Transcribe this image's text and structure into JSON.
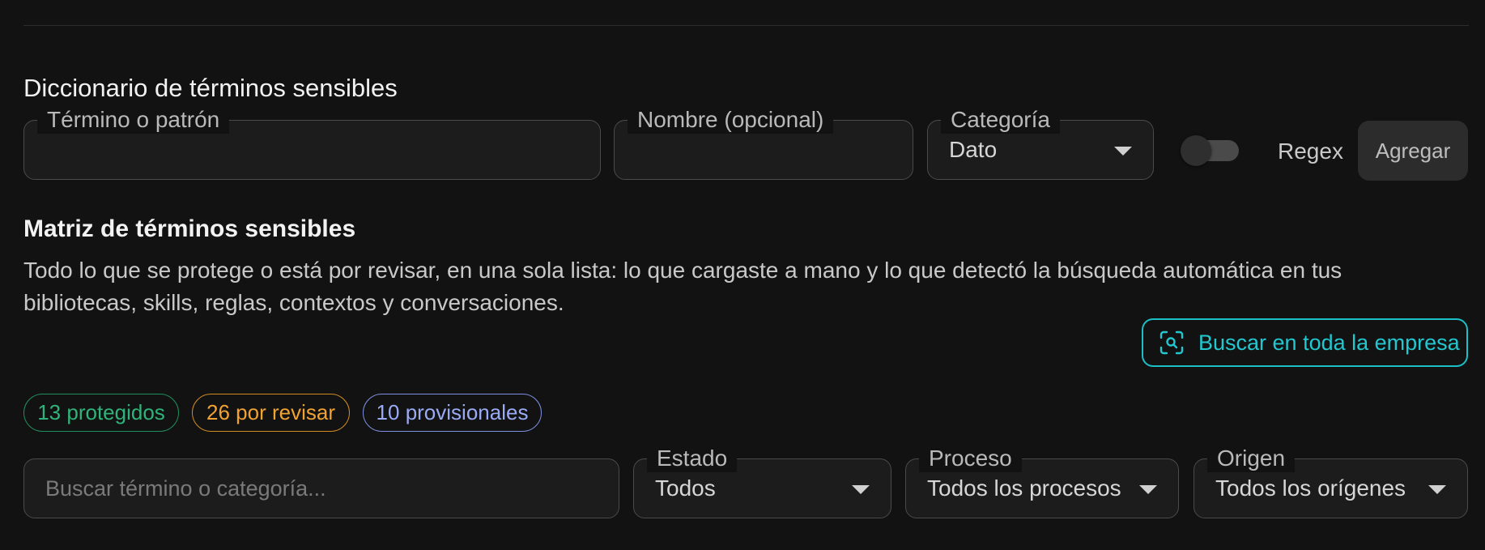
{
  "dictionary": {
    "title": "Diccionario de términos sensibles",
    "term_field": {
      "legend": "Término o patrón",
      "value": ""
    },
    "name_field": {
      "legend": "Nombre (opcional)",
      "value": ""
    },
    "category_field": {
      "legend": "Categoría",
      "value": "Dato"
    },
    "regex": {
      "label": "Regex",
      "enabled": false
    },
    "add_label": "Agregar"
  },
  "matrix": {
    "title": "Matriz de términos sensibles",
    "description": "Todo lo que se protege o está por revisar, en una sola lista: lo que cargaste a mano y lo que detectó la búsqueda automática en tus bibliotecas, skills, reglas, contextos y conversaciones.",
    "scan_button": {
      "label": "Buscar en toda la empresa",
      "icon": "scan-search-icon"
    },
    "chips": {
      "protected": "13 protegidos",
      "review": "26 por revisar",
      "provisional": "10 provisionales"
    },
    "search": {
      "placeholder": "Buscar término o categoría..."
    },
    "filters": {
      "status": {
        "legend": "Estado",
        "value": "Todos"
      },
      "process": {
        "legend": "Proceso",
        "value": "Todos los procesos"
      },
      "origin": {
        "legend": "Origen",
        "value": "Todos los orígenes"
      }
    }
  },
  "colors": {
    "background": "#121212",
    "accent_teal": "#22c7cf",
    "chip_green": "#2fb37a",
    "chip_orange": "#f0a332",
    "chip_blue": "#9aabf5"
  }
}
